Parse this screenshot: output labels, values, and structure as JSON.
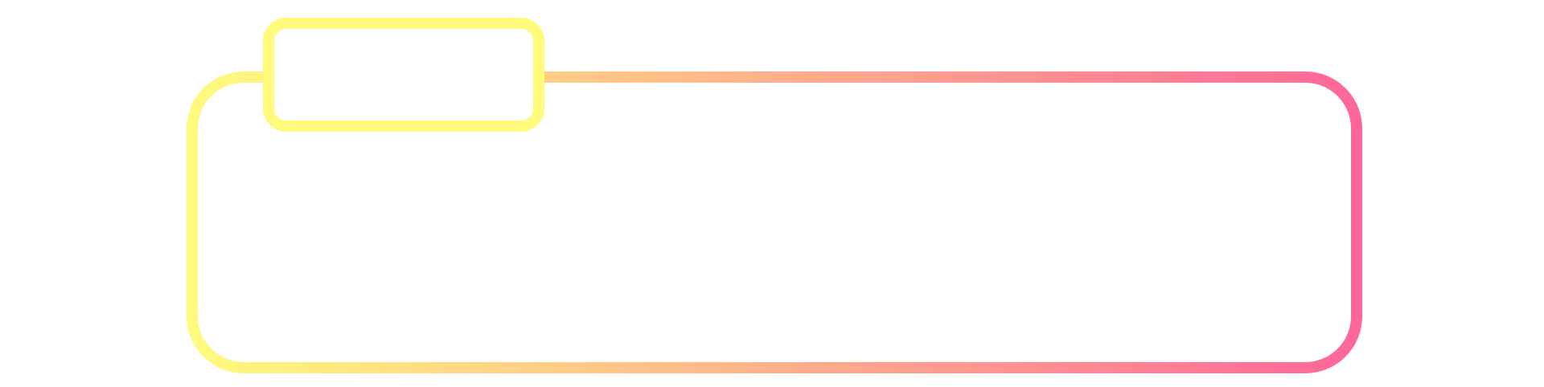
{
  "colors": {
    "gradient_start": "#FFFB7D",
    "gradient_end": "#FF6699",
    "tab_border": "#FFFB7D",
    "background": "#FFFFFF"
  },
  "tab": {
    "label": ""
  },
  "panel": {
    "content": ""
  }
}
